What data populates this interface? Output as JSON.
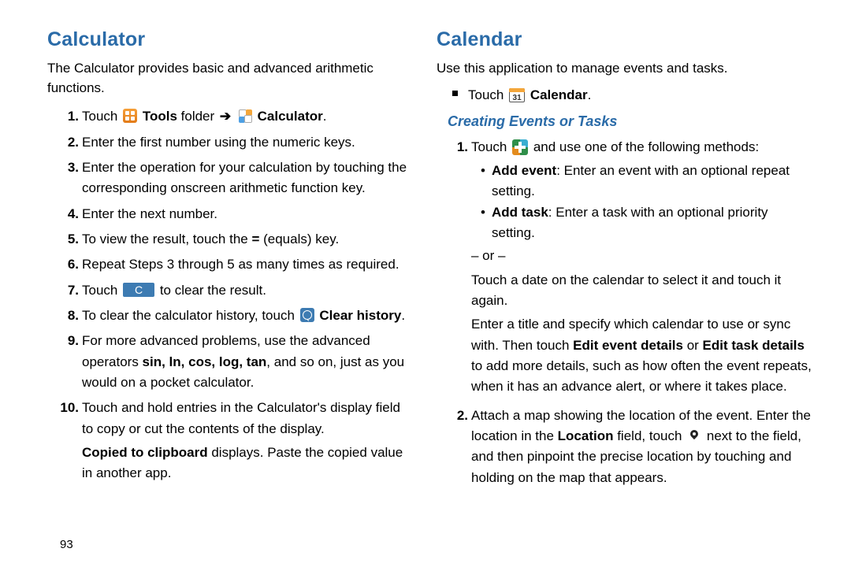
{
  "page_number": "93",
  "left": {
    "heading": "Calculator",
    "intro": "The Calculator provides basic and advanced arithmetic functions.",
    "step1_pre": "Touch ",
    "step1_tools": "Tools",
    "step1_folder": " folder ",
    "step1_arrow": "➔",
    "step1_calc": "Calculator",
    "step1_dot": ".",
    "step2": "Enter the first number using the numeric keys.",
    "step3": "Enter the operation for your calculation by touching the corresponding onscreen arithmetic function key.",
    "step4": "Enter the next number.",
    "step5_a": "To view the result, touch the ",
    "step5_eq": "=",
    "step5_b": " (equals) key.",
    "step6": "Repeat Steps 3 through 5 as many times as required.",
    "step7_a": "Touch ",
    "step7_c": "C",
    "step7_b": " to clear the result.",
    "step8_a": "To clear the calculator history, touch ",
    "step8_ch": "Clear history",
    "step8_dot": ".",
    "step9_a": "For more advanced problems, use the advanced operators ",
    "step9_ops": "sin, ln, cos, log, tan",
    "step9_b": ", and so on, just as you would on a pocket calculator.",
    "step10_a": "Touch and hold entries in the Calculator's display field to copy or cut the contents of the display.",
    "step10_b1": "Copied to clipboard",
    "step10_b2": " displays. Paste the copied value in another app."
  },
  "right": {
    "heading": "Calendar",
    "intro": "Use this application to manage events and tasks.",
    "bullet_pre": "Touch ",
    "bullet_cal": "Calendar",
    "bullet_dot": ".",
    "sub": "Creating Events or Tasks",
    "s1_pre": "Touch ",
    "s1_post": " and use one of the following methods:",
    "s1_ae": "Add event",
    "s1_ae_txt": ": Enter an event with an optional repeat setting.",
    "s1_at": "Add task",
    "s1_at_txt": ": Enter a task with an optional priority setting.",
    "s1_or": "– or –",
    "s1_p1": "Touch a date on the calendar to select it and touch it again.",
    "s1_p2a": "Enter a title and specify which calendar to use or sync with. Then touch ",
    "s1_p2b": "Edit event details",
    "s1_p2c": " or ",
    "s1_p2d": "Edit task details",
    "s1_p2e": " to add more details, such as how often the event repeats, when it has an advance alert, or where it takes place.",
    "s2_a": "Attach a map showing the location of the event. Enter the location in the ",
    "s2_loc": "Location",
    "s2_b": " field, touch ",
    "s2_c": " next to the field, and then pinpoint the precise location by touching and holding on the map that appears."
  }
}
